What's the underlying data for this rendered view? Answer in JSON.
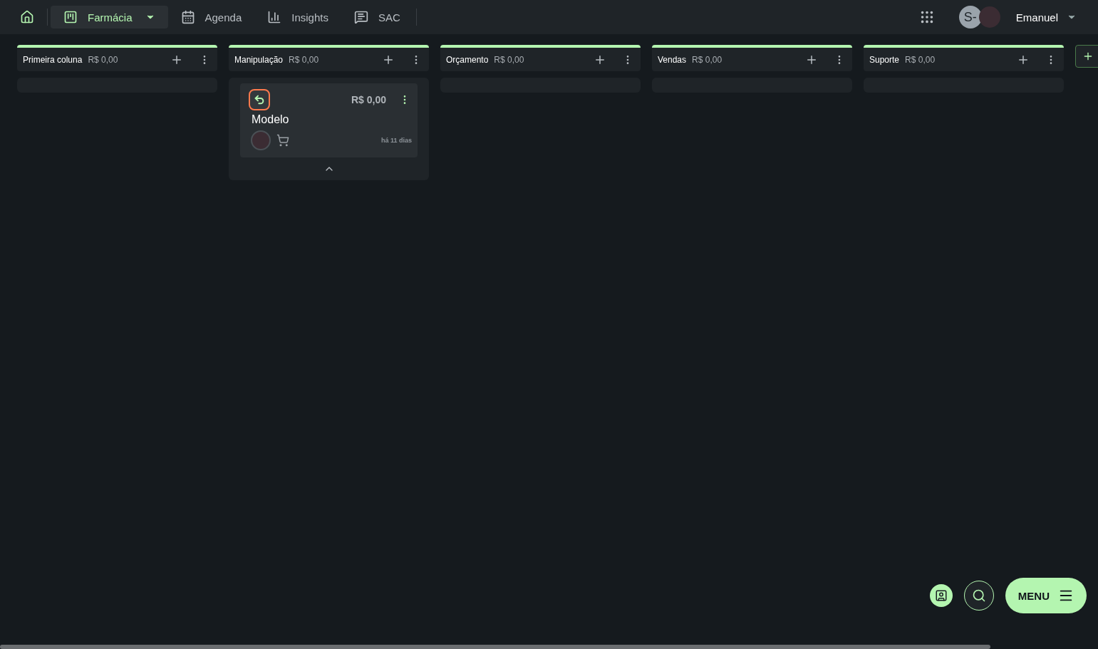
{
  "nav": {
    "items": [
      {
        "kind": "board",
        "label": "Farmácia",
        "selected": true
      },
      {
        "kind": "calendar",
        "label": "Agenda",
        "selected": false
      },
      {
        "kind": "chart",
        "label": "Insights",
        "selected": false
      },
      {
        "kind": "chat",
        "label": "SAC",
        "selected": false
      }
    ],
    "user": {
      "initials": "S-",
      "name": "Emanuel"
    }
  },
  "columns": [
    {
      "name": "Primeira coluna",
      "total": "R$ 0,00"
    },
    {
      "name": "Manipulação",
      "total": "R$ 0,00",
      "cards": [
        {
          "title": "Modelo",
          "value": "R$ 0,00",
          "age": "há 11 dias"
        }
      ]
    },
    {
      "name": "Orçamento",
      "total": "R$ 0,00"
    },
    {
      "name": "Vendas",
      "total": "R$ 0,00"
    },
    {
      "name": "Suporte",
      "total": "R$ 0,00"
    }
  ],
  "menu_button": {
    "label": "MENU"
  }
}
